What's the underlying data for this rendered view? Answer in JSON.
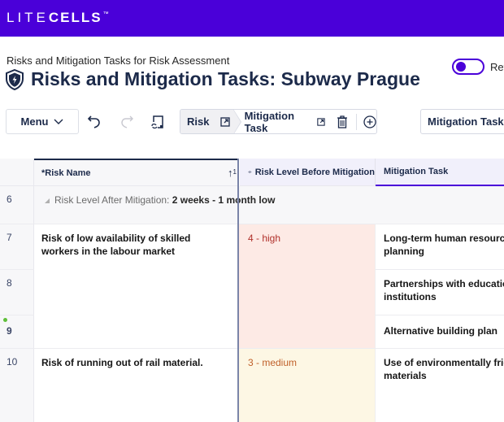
{
  "brand": {
    "lite": "LITE",
    "cells": "CELLS",
    "tm": "™",
    "bar_color": "#4a00d9"
  },
  "header": {
    "subtitle": "Risks and Mitigation Tasks for Risk Assessment",
    "title": "Risks and Mitigation Tasks: Subway Prague",
    "title_icon": "shield-lightning-icon",
    "toggle": {
      "label": "Rev",
      "state": "off"
    }
  },
  "toolbar": {
    "menu_label": "Menu",
    "undo_icon": "undo-icon",
    "redo_icon": "redo-icon",
    "sync_icon": "sync-icon",
    "breadcrumb": {
      "risk_label": "Risk",
      "task_label": "Mitigation Task"
    },
    "task_select_label": "Mitigation Task:"
  },
  "grid": {
    "columns": {
      "name": "*Risk Name",
      "sort_indicator": "1",
      "before": "Risk Level Before Mitigation",
      "task": "Mitigation Task"
    },
    "group_row": {
      "row_num": "6",
      "label": "Risk Level After Mitigation: ",
      "value": "2 weeks - 1 month low"
    },
    "rows": [
      {
        "row_num": "7",
        "name": "Risk of low availability of skilled workers in the labour market",
        "level": "4 - high",
        "task_line1": "Long-term human resources",
        "task_line2": "planning"
      },
      {
        "row_num": "8",
        "task_line1": "Partnerships with education",
        "task_line2": "institutions"
      },
      {
        "row_num": "9",
        "task_line1": "Alternative building plan"
      },
      {
        "row_num": "10",
        "name": "Risk of running out of rail material.",
        "level": "3 - medium",
        "task_line1": "Use of environmentally frien",
        "task_line2": "materials"
      }
    ],
    "level_colors": {
      "high_bg": "#fdeae5",
      "high_text": "#b0302a",
      "medium_bg": "#fdf7e4",
      "medium_text": "#c0602a"
    }
  }
}
